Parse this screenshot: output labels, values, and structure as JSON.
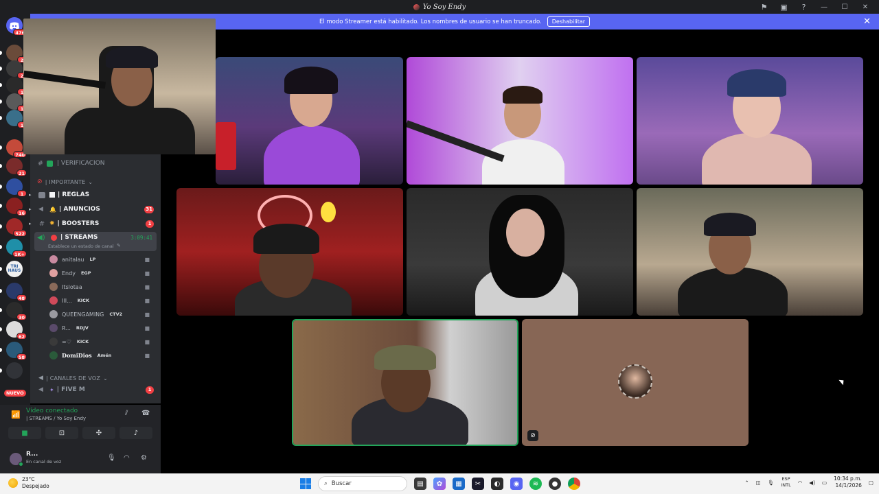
{
  "window": {
    "title": "Yo Soy Endy"
  },
  "titlebar_icons": [
    "inbox-icon",
    "screen-share-icon",
    "help-icon"
  ],
  "banner": {
    "message": "El modo Streamer está habilitado. Los nombres de usuario se han truncado.",
    "button": "Deshabilitar"
  },
  "rail": {
    "top_badge": "476",
    "servers": [
      {
        "badge": "2",
        "color": "#6a4b3a"
      },
      {
        "badge": "2",
        "color": "#3b3b3b"
      },
      {
        "badge": "1",
        "color": "#2a2a2a"
      },
      {
        "badge": "1",
        "color": "#5a5a5a"
      },
      {
        "badge": "1",
        "color": "#3a6f8a"
      },
      {
        "badge": "740",
        "color": "#c44a3a"
      },
      {
        "badge": "21",
        "color": "#7a2b2b"
      },
      {
        "badge": "1",
        "color": "#2f4fa0"
      },
      {
        "badge": "16",
        "color": "#8a2020"
      },
      {
        "badge": "522",
        "color": "#a02828"
      },
      {
        "badge": "1K+",
        "color": "#1f8fa8"
      },
      {
        "badge": "",
        "color": "#f0f0f0",
        "label": "TRI HAUS"
      },
      {
        "badge": "48",
        "color": "#2a3a6a"
      },
      {
        "badge": "30",
        "color": "#2b2b2b"
      },
      {
        "badge": "62",
        "color": "#dcdcdc"
      },
      {
        "badge": "58",
        "color": "#2a5a7a"
      },
      {
        "badge": "",
        "color": "#313338"
      }
    ],
    "new_label": "NUEVO"
  },
  "channels": {
    "verificacion": "| VERIFICACION",
    "category_importante": "| IMPORTANTE",
    "reglas": "| REGLAS",
    "anuncios": "| ANUNCIOS",
    "anuncios_badge": "31",
    "boosters": "| BOOSTERS",
    "boosters_badge": "1",
    "streams": "| STREAMS",
    "streams_timer": "3:09:41",
    "streams_status": "Establece un estado de canal",
    "category_voz": "| CANALES DE VOZ",
    "fivem": "| FIVE M",
    "fivem_badge": "1"
  },
  "voice_users": [
    {
      "name": "anitalau",
      "tag": "LP",
      "color": "#c98aa0"
    },
    {
      "name": "Endy",
      "tag": "EGP",
      "color": "#e0a0a0"
    },
    {
      "name": "Itslotaa",
      "tag": "",
      "color": "#8a6a5a"
    },
    {
      "name": "III...",
      "tag": "KICK",
      "color": "#d04a5a"
    },
    {
      "name": "QUEENGAMING",
      "tag": "CTV2",
      "color": "#9a9aa0"
    },
    {
      "name": "R...",
      "tag": "RDJV",
      "color": "#5a4a6a"
    },
    {
      "name": "=♡",
      "tag": "KICK",
      "color": "#3a3a3a"
    },
    {
      "name": "DomiDios",
      "tag": "Amén",
      "color": "#2a5a3a"
    }
  ],
  "voice_panel": {
    "status": "Vídeo conectado",
    "channel": "| STREAMS / Yo Soy Endy"
  },
  "user_panel": {
    "name": "R...",
    "status": "En canal de voz"
  },
  "taskbar": {
    "temp": "23°C",
    "weather": "Despejado",
    "search": "Buscar",
    "lang1": "ESP",
    "lang2": "INTL",
    "time": "10:34 p.m.",
    "date": "14/1/2026"
  },
  "colors": {
    "accent": "#5865f2",
    "online": "#23a55a",
    "badge": "#f23f43"
  }
}
